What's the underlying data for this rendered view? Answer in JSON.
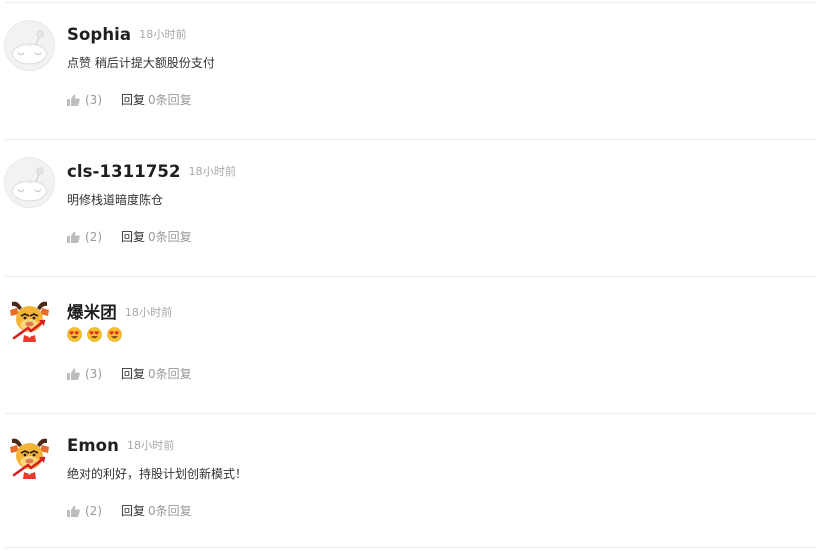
{
  "comments": [
    {
      "username": "Sophia",
      "time": "18小时前",
      "text": "点赞 稍后计提大额股份支付",
      "likes": "(3)",
      "reply_label": "回复",
      "reply_count": "0条回复",
      "avatar": "default-avatar-icon"
    },
    {
      "username": "cls-1311752",
      "time": "18小时前",
      "text": "明修栈道暗度陈仓",
      "likes": "(2)",
      "reply_label": "回复",
      "reply_count": "0条回复",
      "avatar": "default-avatar-icon"
    },
    {
      "username": "爆米团",
      "time": "18小时前",
      "emojis": [
        "heart-eyes-emoji",
        "heart-eyes-emoji",
        "heart-eyes-emoji"
      ],
      "likes": "(3)",
      "reply_label": "回复",
      "reply_count": "0条回复",
      "avatar": "bull-mascot-avatar"
    },
    {
      "username": "Emon",
      "time": "18小时前",
      "text": "绝对的利好，持股计划创新模式！",
      "likes": "(2)",
      "reply_label": "回复",
      "reply_count": "0条回复",
      "avatar": "bull-mascot-avatar"
    }
  ],
  "colors": {
    "username": "#1f1f1f",
    "text": "#333333",
    "meta": "#999999",
    "separator": "#ebebeb"
  }
}
